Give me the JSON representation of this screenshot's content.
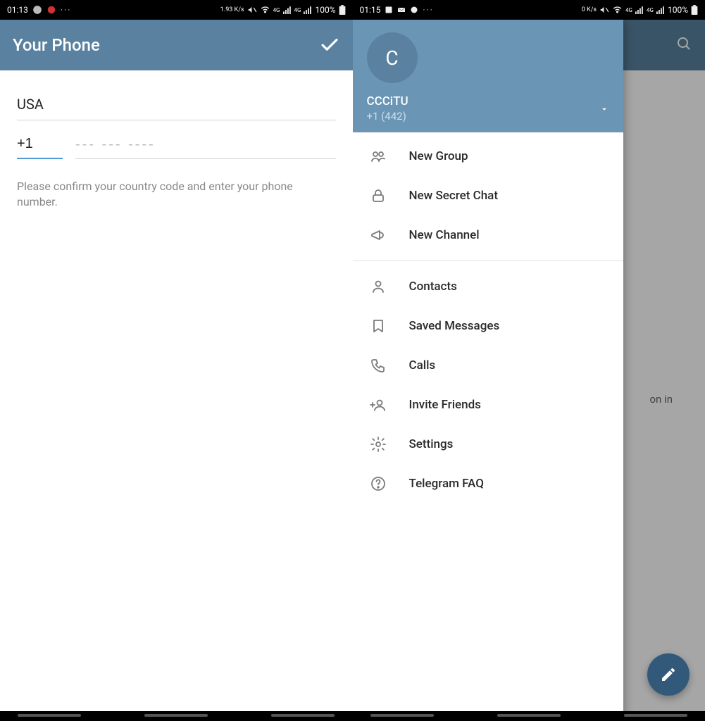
{
  "left": {
    "status": {
      "time": "01:13",
      "speed": "1.93 K/s",
      "net1": "4G",
      "net2": "4G",
      "battery": "100%"
    },
    "toolbar": {
      "title": "Your Phone"
    },
    "form": {
      "country": "USA",
      "code": "+1",
      "placeholder": "--- --- ----",
      "hint": "Please confirm your country code and enter your phone number."
    }
  },
  "right": {
    "status": {
      "time": "01:15",
      "speed": "0 K/s",
      "net1": "4G",
      "net2": "4G",
      "battery": "100%"
    },
    "background_text_fragment": "on in",
    "drawer": {
      "avatar_initial": "C",
      "username": "CCCiTU",
      "phone": "+1 (442)",
      "groups": [
        [
          {
            "icon": "group",
            "label": "New Group",
            "name": "drawer-new-group"
          },
          {
            "icon": "lock",
            "label": "New Secret Chat",
            "name": "drawer-new-secret-chat"
          },
          {
            "icon": "megaphone",
            "label": "New Channel",
            "name": "drawer-new-channel"
          }
        ],
        [
          {
            "icon": "person",
            "label": "Contacts",
            "name": "drawer-contacts"
          },
          {
            "icon": "bookmark",
            "label": "Saved Messages",
            "name": "drawer-saved-messages"
          },
          {
            "icon": "phone",
            "label": "Calls",
            "name": "drawer-calls"
          },
          {
            "icon": "invite",
            "label": "Invite Friends",
            "name": "drawer-invite-friends"
          },
          {
            "icon": "gear",
            "label": "Settings",
            "name": "drawer-settings"
          },
          {
            "icon": "help",
            "label": "Telegram FAQ",
            "name": "drawer-faq"
          }
        ]
      ]
    }
  }
}
